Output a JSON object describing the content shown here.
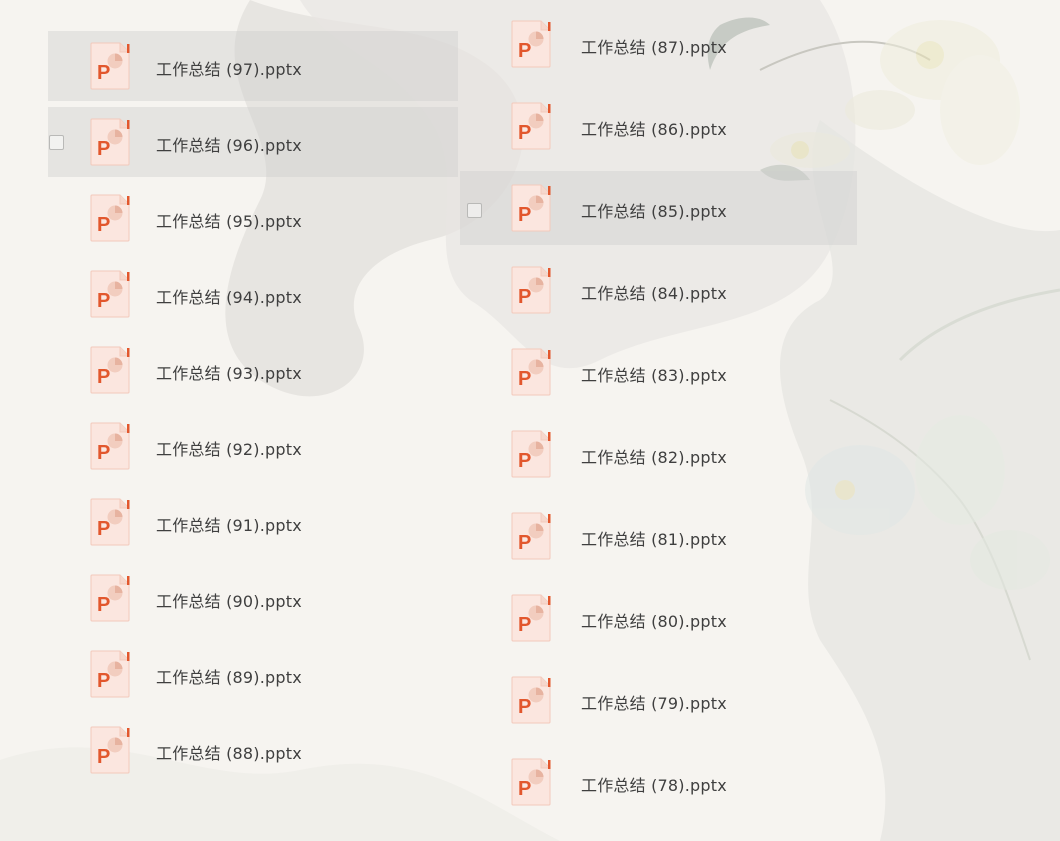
{
  "files_left": [
    {
      "name": "工作总结 (97).pptx",
      "selected": true,
      "checkbox": false
    },
    {
      "name": "工作总结 (96).pptx",
      "selected": true,
      "checkbox": true
    },
    {
      "name": "工作总结 (95).pptx",
      "selected": false,
      "checkbox": false
    },
    {
      "name": "工作总结 (94).pptx",
      "selected": false,
      "checkbox": false
    },
    {
      "name": "工作总结 (93).pptx",
      "selected": false,
      "checkbox": false
    },
    {
      "name": "工作总结 (92).pptx",
      "selected": false,
      "checkbox": false
    },
    {
      "name": "工作总结 (91).pptx",
      "selected": false,
      "checkbox": false
    },
    {
      "name": "工作总结 (90).pptx",
      "selected": false,
      "checkbox": false
    },
    {
      "name": "工作总结 (89).pptx",
      "selected": false,
      "checkbox": false
    },
    {
      "name": "工作总结 (88).pptx",
      "selected": false,
      "checkbox": false
    }
  ],
  "files_right": [
    {
      "name": "工作总结 (87).pptx",
      "selected": false,
      "checkbox": false
    },
    {
      "name": "工作总结 (86).pptx",
      "selected": false,
      "checkbox": false
    },
    {
      "name": "工作总结 (85).pptx",
      "selected": true,
      "checkbox": true
    },
    {
      "name": "工作总结 (84).pptx",
      "selected": false,
      "checkbox": false
    },
    {
      "name": "工作总结 (83).pptx",
      "selected": false,
      "checkbox": false
    },
    {
      "name": "工作总结 (82).pptx",
      "selected": false,
      "checkbox": false
    },
    {
      "name": "工作总结 (81).pptx",
      "selected": false,
      "checkbox": false
    },
    {
      "name": "工作总结 (80).pptx",
      "selected": false,
      "checkbox": false
    },
    {
      "name": "工作总结 (79).pptx",
      "selected": false,
      "checkbox": false
    },
    {
      "name": "工作总结 (78).pptx",
      "selected": false,
      "checkbox": false
    }
  ],
  "icon": "pptx-file-icon",
  "colors": {
    "icon_accent": "#e2572d",
    "selected_row": "#d6d5d3"
  }
}
